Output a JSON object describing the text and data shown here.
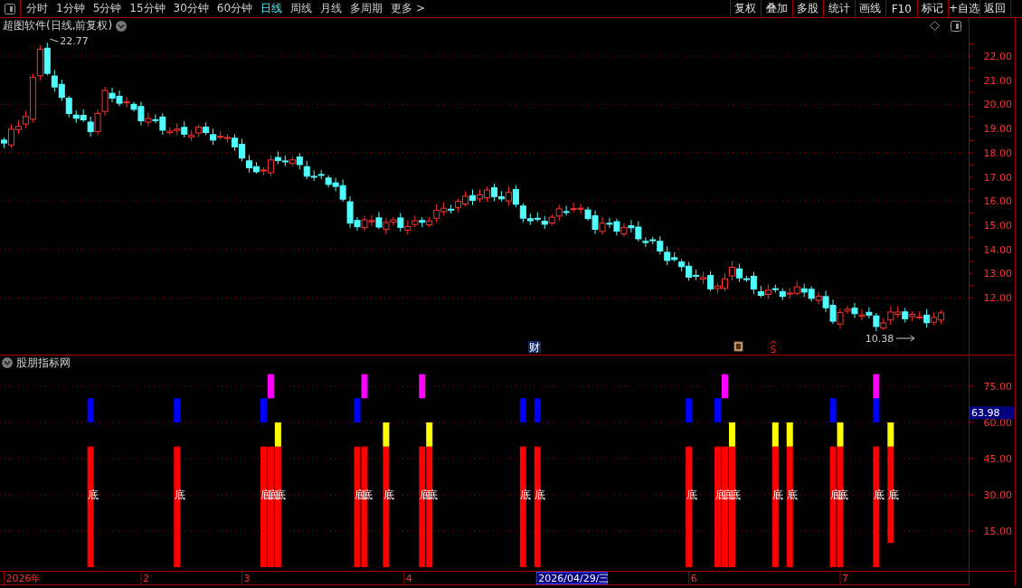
{
  "toolbar": {
    "tabs": [
      {
        "label": "分时",
        "selected": false
      },
      {
        "label": "1分钟",
        "selected": false
      },
      {
        "label": "5分钟",
        "selected": false
      },
      {
        "label": "15分钟",
        "selected": false
      },
      {
        "label": "30分钟",
        "selected": false
      },
      {
        "label": "60分钟",
        "selected": false
      },
      {
        "label": "日线",
        "selected": true
      },
      {
        "label": "周线",
        "selected": false
      },
      {
        "label": "月线",
        "selected": false
      },
      {
        "label": "多周期",
        "selected": false
      },
      {
        "label": "更多 >",
        "selected": false
      }
    ],
    "buttons": [
      "复权",
      "叠加",
      "多股",
      "统计",
      "画线",
      "F10",
      "标记",
      "+自选",
      "返回"
    ]
  },
  "price_pane": {
    "title": "超图软件(日线,前复权)",
    "y_labels": [
      "22.00",
      "21.00",
      "20.00",
      "19.00",
      "18.00",
      "17.00",
      "16.00",
      "15.00",
      "14.00",
      "13.00",
      "12.00"
    ],
    "high_label": "22.77",
    "low_label": "10.38",
    "event_markers": [
      {
        "kind": "badge",
        "text": "财"
      },
      {
        "kind": "icon"
      },
      {
        "kind": "text",
        "text": "S"
      }
    ]
  },
  "indicator_pane": {
    "title": "股朋指标网",
    "current_value": "63.98",
    "y_labels": [
      "75.00",
      "60.00",
      "45.00",
      "30.00",
      "15.00"
    ],
    "signals": [
      {
        "label": "底",
        "bars": [
          {
            "kind": "blue"
          }
        ]
      },
      {
        "label": "底",
        "bars": [
          {
            "kind": "blue"
          }
        ]
      },
      {
        "label": "底底底",
        "bars": [
          {
            "kind": "blue"
          },
          {
            "kind": "magenta"
          },
          {
            "kind": "yellow"
          }
        ]
      },
      {
        "label": "底底",
        "bars": [
          {
            "kind": "blue"
          },
          {
            "kind": "magenta"
          }
        ]
      },
      {
        "label": "底",
        "bars": [
          {
            "kind": "yellow"
          }
        ]
      },
      {
        "label": "底底",
        "bars": [
          {
            "kind": "magenta"
          },
          {
            "kind": "yellow"
          }
        ]
      },
      {
        "label": "底",
        "bars": [
          {
            "kind": "blue"
          }
        ]
      },
      {
        "label": "底",
        "bars": [
          {
            "kind": "blue"
          }
        ]
      },
      {
        "label": "底",
        "bars": [
          {
            "kind": "blue"
          }
        ]
      },
      {
        "label": "底底底",
        "bars": [
          {
            "kind": "blue"
          },
          {
            "kind": "magenta"
          },
          {
            "kind": "yellow"
          }
        ]
      },
      {
        "label": "底",
        "bars": [
          {
            "kind": "yellow"
          }
        ]
      },
      {
        "label": "底",
        "bars": [
          {
            "kind": "yellow"
          }
        ]
      },
      {
        "label": "底底",
        "bars": [
          {
            "kind": "blue"
          },
          {
            "kind": "yellow"
          }
        ]
      },
      {
        "label": "底",
        "bars": [
          {
            "kind": "blue-magenta"
          }
        ]
      },
      {
        "label": "底",
        "bars": [
          {
            "kind": "yellow-short"
          }
        ]
      }
    ]
  },
  "x_axis": {
    "labels": [
      "2026年",
      "2",
      "3",
      "4",
      "6",
      "7"
    ],
    "cursor_label": "2026/04/29/三"
  }
}
